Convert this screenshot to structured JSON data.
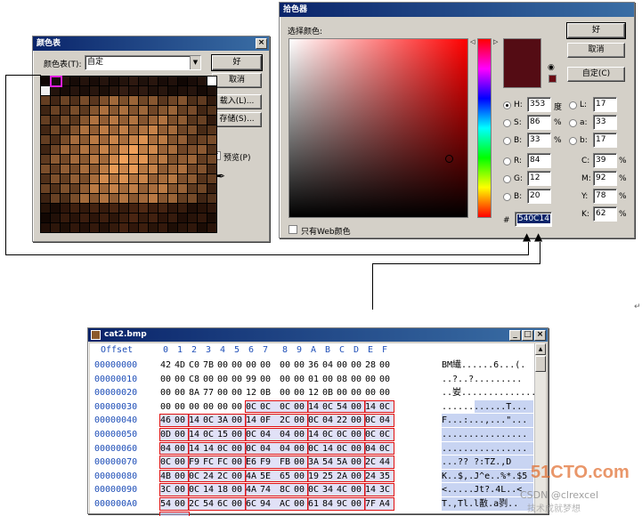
{
  "palette_dialog": {
    "title": "颜色表",
    "label": "颜色表(T):",
    "select_value": "自定",
    "ok": "好",
    "cancel": "取消",
    "load": "载入(L)...",
    "save": "存储(S)...",
    "preview": "预览(P)",
    "preview_checked": true
  },
  "picker_dialog": {
    "title": "拾色器",
    "choose_label": "选择颜色:",
    "ok": "好",
    "cancel": "取消",
    "custom": "自定(C)",
    "web_only": "只有Web颜色",
    "hex_prefix": "#",
    "hex": "540C14",
    "swatch_color": "#540c14",
    "hsb": [
      {
        "label": "H:",
        "value": "353",
        "unit": "度",
        "selected": true
      },
      {
        "label": "S:",
        "value": "86",
        "unit": "%",
        "selected": false
      },
      {
        "label": "B:",
        "value": "33",
        "unit": "%",
        "selected": false
      }
    ],
    "rgb": [
      {
        "label": "R:",
        "value": "84"
      },
      {
        "label": "G:",
        "value": "12"
      },
      {
        "label": "B:",
        "value": "20"
      }
    ],
    "lab": [
      {
        "label": "L:",
        "value": "17"
      },
      {
        "label": "a:",
        "value": "33"
      },
      {
        "label": "b:",
        "value": "17"
      }
    ],
    "cmyk": [
      {
        "label": "C:",
        "value": "39",
        "unit": "%"
      },
      {
        "label": "M:",
        "value": "92",
        "unit": "%"
      },
      {
        "label": "Y:",
        "value": "78",
        "unit": "%"
      },
      {
        "label": "K:",
        "value": "62",
        "unit": "%"
      }
    ]
  },
  "hex_editor": {
    "title": "cat2.bmp",
    "offset_header": "Offset",
    "col_headers": [
      "0",
      "1",
      "2",
      "3",
      "4",
      "5",
      "6",
      "7",
      "8",
      "9",
      "A",
      "B",
      "C",
      "D",
      "E",
      "F"
    ],
    "rows": [
      {
        "offset": "00000000",
        "bytes": [
          "42",
          "4D",
          "C0",
          "7B",
          "00",
          "00",
          "00",
          "00",
          "00",
          "00",
          "36",
          "04",
          "00",
          "00",
          "28",
          "00"
        ],
        "ascii": "BM繊......6...(."
      },
      {
        "offset": "00000010",
        "bytes": [
          "00",
          "00",
          "C8",
          "00",
          "00",
          "00",
          "99",
          "00",
          "00",
          "00",
          "01",
          "00",
          "08",
          "00",
          "00",
          "00"
        ],
        "ascii": "..?..?........."
      },
      {
        "offset": "00000020",
        "bytes": [
          "00",
          "00",
          "8A",
          "77",
          "00",
          "00",
          "12",
          "0B",
          "00",
          "00",
          "12",
          "0B",
          "00",
          "00",
          "00",
          "00"
        ],
        "ascii": "..妛.............."
      },
      {
        "offset": "00000030",
        "bytes": [
          "00",
          "00",
          "00",
          "00",
          "00",
          "00",
          "0C",
          "0C",
          "0C",
          "00",
          "14",
          "0C",
          "54",
          "00",
          "14",
          "0C"
        ],
        "ascii": "............T..."
      },
      {
        "offset": "00000040",
        "bytes": [
          "46",
          "00",
          "14",
          "0C",
          "3A",
          "00",
          "14",
          "0F",
          "2C",
          "00",
          "0C",
          "04",
          "22",
          "00",
          "0C",
          "04"
        ],
        "ascii": "F...:...,...\"..."
      },
      {
        "offset": "00000050",
        "bytes": [
          "0D",
          "00",
          "14",
          "0C",
          "15",
          "00",
          "0C",
          "04",
          "04",
          "00",
          "14",
          "0C",
          "0C",
          "00",
          "0C",
          "0C"
        ],
        "ascii": "................"
      },
      {
        "offset": "00000060",
        "bytes": [
          "04",
          "00",
          "14",
          "14",
          "0C",
          "00",
          "0C",
          "04",
          "04",
          "00",
          "0C",
          "14",
          "0C",
          "00",
          "04",
          "0C"
        ],
        "ascii": "................"
      },
      {
        "offset": "00000070",
        "bytes": [
          "0C",
          "00",
          "F9",
          "FC",
          "FC",
          "00",
          "E6",
          "F9",
          "FB",
          "00",
          "3A",
          "54",
          "5A",
          "00",
          "2C",
          "44"
        ],
        "ascii": "...?? ?:TZ.,D"
      },
      {
        "offset": "00000080",
        "bytes": [
          "4B",
          "00",
          "0C",
          "24",
          "2C",
          "00",
          "4A",
          "5E",
          "65",
          "00",
          "19",
          "25",
          "2A",
          "00",
          "24",
          "35"
        ],
        "ascii": "K..$,.J^e..%*.$5"
      },
      {
        "offset": "00000090",
        "bytes": [
          "3C",
          "00",
          "0C",
          "14",
          "18",
          "00",
          "4A",
          "74",
          "8C",
          "00",
          "0C",
          "34",
          "4C",
          "00",
          "14",
          "3C"
        ],
        "ascii": "<.....Jt?.4L..<"
      },
      {
        "offset": "000000A0",
        "bytes": [
          "54",
          "00",
          "2C",
          "54",
          "6C",
          "00",
          "6C",
          "94",
          "AC",
          "00",
          "61",
          "84",
          "9C",
          "00",
          "7F",
          "A4"
        ],
        "ascii": "T.,Tl.l敾.a剹.."
      }
    ]
  },
  "watermark": {
    "site": "51CTO.com",
    "sub": "CSDN @clrexcel",
    "sub2": "技术成就梦想"
  },
  "colors": {
    "title_bar": "#0a246a",
    "highlight_border": "#e01010",
    "offset_text": "#1f4fb8"
  }
}
